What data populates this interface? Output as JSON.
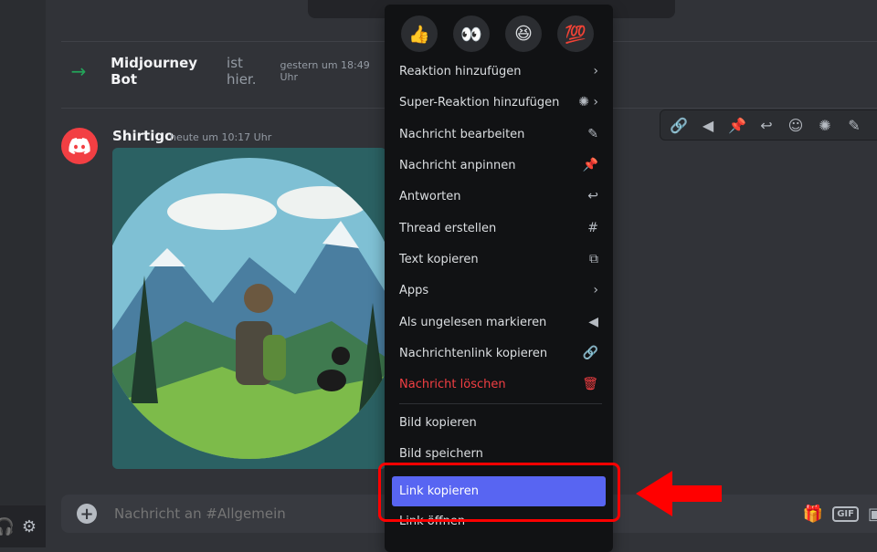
{
  "join_notice": {
    "user": "Midjourney Bot",
    "text": "ist hier.",
    "time": "gestern um 18:49 Uhr"
  },
  "message": {
    "author": "Shirtigo",
    "time": "heute um 10:17 Uhr"
  },
  "composer": {
    "placeholder": "Nachricht an #Allgemein",
    "gif_label": "GIF"
  },
  "reactions": [
    {
      "emoji": "👍",
      "icon": "thumbs-up-emoji"
    },
    {
      "emoji": "👀",
      "icon": "eyes-emoji"
    },
    {
      "emoji": "😆",
      "icon": "laughing-emoji"
    },
    {
      "emoji": "💯",
      "icon": "hundred-points-emoji"
    }
  ],
  "context_menu": {
    "items": [
      {
        "label": "Reaktion hinzufügen",
        "icon": "chevron-right-icon"
      },
      {
        "label": "Super-Reaktion hinzufügen",
        "icon": "super-reaction-icon"
      },
      {
        "label": "Nachricht bearbeiten",
        "icon": "pencil-icon"
      },
      {
        "label": "Nachricht anpinnen",
        "icon": "pin-icon"
      },
      {
        "label": "Antworten",
        "icon": "reply-icon"
      },
      {
        "label": "Thread erstellen",
        "icon": "thread-icon"
      },
      {
        "label": "Text kopieren",
        "icon": "copy-icon"
      },
      {
        "label": "Apps",
        "icon": "chevron-right-icon"
      },
      {
        "label": "Als ungelesen markieren",
        "icon": "unread-flag-icon"
      },
      {
        "label": "Nachrichtenlink kopieren",
        "icon": "link-icon"
      },
      {
        "label": "Nachricht löschen",
        "icon": "trash-icon"
      }
    ],
    "image_items": [
      {
        "label": "Bild kopieren"
      },
      {
        "label": "Bild speichern"
      },
      {
        "label": "Link kopieren"
      },
      {
        "label": "Link öffnen"
      }
    ]
  },
  "colors": {
    "background": "#313338",
    "menu_bg": "#111214",
    "accent": "#5865f2",
    "danger": "#f23f43",
    "annotation": "#ff0000"
  }
}
